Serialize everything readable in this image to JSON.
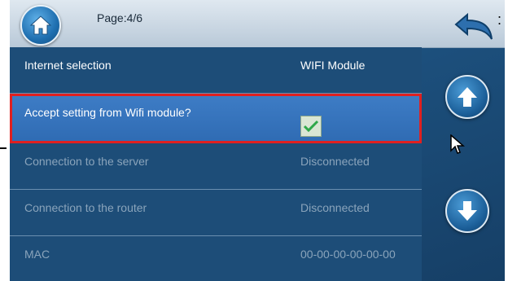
{
  "header": {
    "page_label": "Page:4/6",
    "home_icon": "home-icon",
    "back_icon": "back-arrow-icon"
  },
  "settings": [
    {
      "label": "Internet selection",
      "value": "WIFI Module",
      "state": "active"
    },
    {
      "label": "Accept setting from Wifi module?",
      "checked": true,
      "state": "selected"
    },
    {
      "label": "Connection to the server",
      "value": "Disconnected",
      "state": "inactive"
    },
    {
      "label": "Connection to the router",
      "value": "Disconnected",
      "state": "inactive"
    },
    {
      "label": "MAC",
      "value": "00-00-00-00-00-00",
      "state": "inactive"
    }
  ],
  "scroll": {
    "up_icon": "arrow-up-icon",
    "down_icon": "arrow-down-icon"
  },
  "colors": {
    "highlight_outline": "#e02020",
    "selected_row": "#3e7dc6",
    "list_bg": "#1d4d78",
    "check_green": "#2fa84a"
  }
}
